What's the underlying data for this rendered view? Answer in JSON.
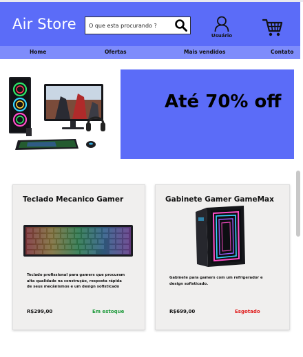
{
  "header": {
    "brand": "Air Store",
    "search_placeholder": "O que esta procurando ?",
    "user_label": "Usuário",
    "icons": {
      "search": "search-icon",
      "user": "user-icon",
      "cart": "cart-icon"
    }
  },
  "nav": {
    "items": [
      {
        "label": "Home"
      },
      {
        "label": "Ofertas"
      },
      {
        "label": "Mais vendidos"
      },
      {
        "label": "Contato"
      }
    ]
  },
  "banner": {
    "image": "gaming-pc-setup",
    "promo_text": "Até 70% off"
  },
  "products": [
    {
      "title": "Teclado Mecanico Gamer",
      "image": "rgb-mechanical-keyboard",
      "description": "Teclado profissional para gamers que procuram alta qualidade na construção, resposta rápida de seus mecânismos e um design sofisticado",
      "price": "R$299,00",
      "status": "Em estoque"
    },
    {
      "title": "Gabinete Gamer GameMax",
      "image": "gamer-pc-case",
      "description": "Gabinete  para gamers com um  refrigerador e design sofisticado.",
      "price": "R$699,00",
      "status": "Esgotado"
    }
  ],
  "colors": {
    "header_bg": "#5b6cf8",
    "nav_bg": "#7e8cfb",
    "in_stock": "#1f9a3c",
    "sold_out": "#e01b1b"
  }
}
